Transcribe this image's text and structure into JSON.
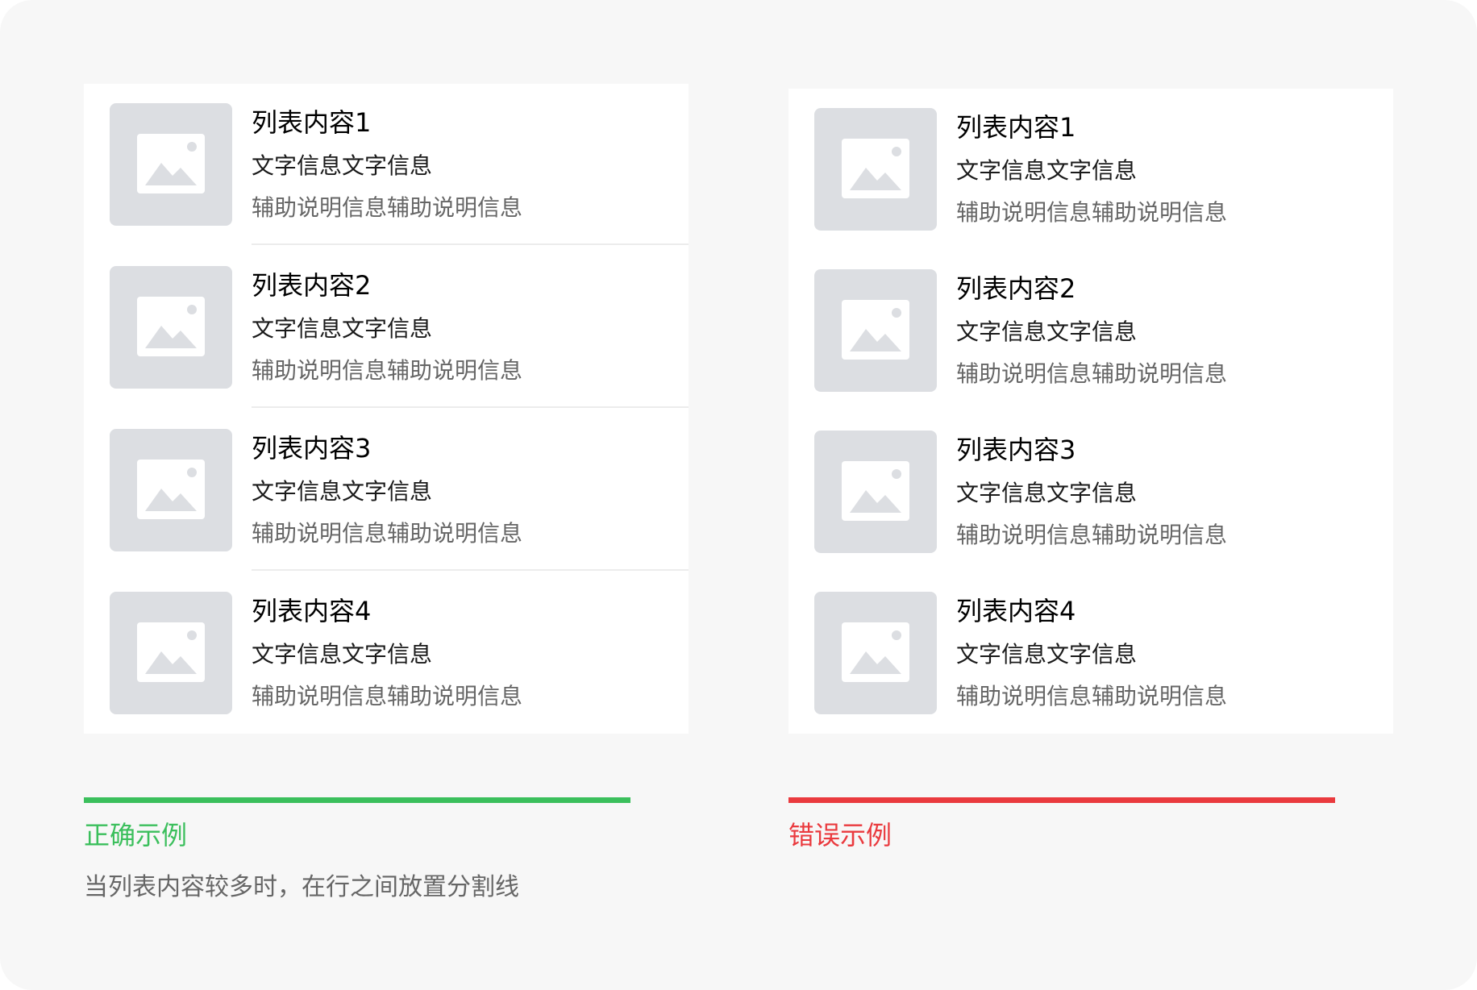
{
  "colors": {
    "page_bg": "#f7f7f7",
    "panel_bg": "#ffffff",
    "thumb_bg": "#dcdee2",
    "divider": "#ececec",
    "correct": "#3bbf5c",
    "wrong": "#ea3a3e",
    "secondary_text": "#666666"
  },
  "correct_example": {
    "label": "正确示例",
    "description": "当列表内容较多时，在行之间放置分割线",
    "items": [
      {
        "title": "列表内容1",
        "text": "文字信息文字信息",
        "aux": "辅助说明信息辅助说明信息",
        "icon": "image-placeholder-icon"
      },
      {
        "title": "列表内容2",
        "text": "文字信息文字信息",
        "aux": "辅助说明信息辅助说明信息",
        "icon": "image-placeholder-icon"
      },
      {
        "title": "列表内容3",
        "text": "文字信息文字信息",
        "aux": "辅助说明信息辅助说明信息",
        "icon": "image-placeholder-icon"
      },
      {
        "title": "列表内容4",
        "text": "文字信息文字信息",
        "aux": "辅助说明信息辅助说明信息",
        "icon": "image-placeholder-icon"
      }
    ]
  },
  "wrong_example": {
    "label": "错误示例",
    "items": [
      {
        "title": "列表内容1",
        "text": "文字信息文字信息",
        "aux": "辅助说明信息辅助说明信息",
        "icon": "image-placeholder-icon"
      },
      {
        "title": "列表内容2",
        "text": "文字信息文字信息",
        "aux": "辅助说明信息辅助说明信息",
        "icon": "image-placeholder-icon"
      },
      {
        "title": "列表内容3",
        "text": "文字信息文字信息",
        "aux": "辅助说明信息辅助说明信息",
        "icon": "image-placeholder-icon"
      },
      {
        "title": "列表内容4",
        "text": "文字信息文字信息",
        "aux": "辅助说明信息辅助说明信息",
        "icon": "image-placeholder-icon"
      }
    ]
  }
}
